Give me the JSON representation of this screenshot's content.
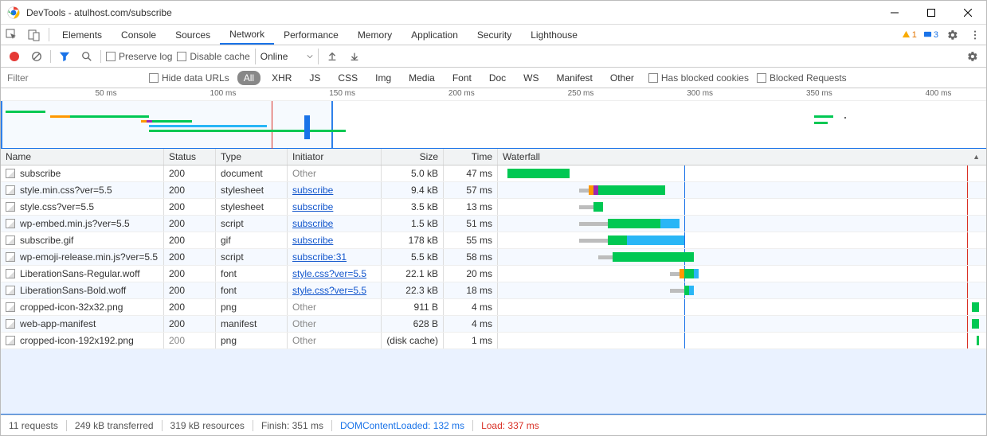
{
  "title": "DevTools - atulhost.com/subscribe",
  "tabs": [
    "Elements",
    "Console",
    "Sources",
    "Network",
    "Performance",
    "Memory",
    "Application",
    "Security",
    "Lighthouse"
  ],
  "active_tab": "Network",
  "badges": {
    "warnings": "1",
    "messages": "3"
  },
  "toolbar": {
    "preserve_log": "Preserve log",
    "disable_cache": "Disable cache",
    "online": "Online"
  },
  "filters": {
    "placeholder": "Filter",
    "hide_data_urls": "Hide data URLs",
    "types": [
      "All",
      "XHR",
      "JS",
      "CSS",
      "Img",
      "Media",
      "Font",
      "Doc",
      "WS",
      "Manifest",
      "Other"
    ],
    "has_blocked_cookies": "Has blocked cookies",
    "blocked_requests": "Blocked Requests"
  },
  "overview": {
    "ticks": [
      "50 ms",
      "100 ms",
      "150 ms",
      "200 ms",
      "250 ms",
      "300 ms",
      "350 ms",
      "400 ms"
    ]
  },
  "columns": [
    "Name",
    "Status",
    "Type",
    "Initiator",
    "Size",
    "Time",
    "Waterfall"
  ],
  "requests": [
    {
      "name": "subscribe",
      "status": "200",
      "type": "document",
      "initiator": "Other",
      "initiator_link": false,
      "size": "5.0 kB",
      "time": "47 ms"
    },
    {
      "name": "style.min.css?ver=5.5",
      "status": "200",
      "type": "stylesheet",
      "initiator": "subscribe",
      "initiator_link": true,
      "size": "9.4 kB",
      "time": "57 ms"
    },
    {
      "name": "style.css?ver=5.5",
      "status": "200",
      "type": "stylesheet",
      "initiator": "subscribe",
      "initiator_link": true,
      "size": "3.5 kB",
      "time": "13 ms"
    },
    {
      "name": "wp-embed.min.js?ver=5.5",
      "status": "200",
      "type": "script",
      "initiator": "subscribe",
      "initiator_link": true,
      "size": "1.5 kB",
      "time": "51 ms"
    },
    {
      "name": "subscribe.gif",
      "status": "200",
      "type": "gif",
      "initiator": "subscribe",
      "initiator_link": true,
      "size": "178 kB",
      "time": "55 ms"
    },
    {
      "name": "wp-emoji-release.min.js?ver=5.5",
      "status": "200",
      "type": "script",
      "initiator": "subscribe:31",
      "initiator_link": true,
      "size": "5.5 kB",
      "time": "58 ms"
    },
    {
      "name": "LiberationSans-Regular.woff",
      "status": "200",
      "type": "font",
      "initiator": "style.css?ver=5.5",
      "initiator_link": true,
      "size": "22.1 kB",
      "time": "20 ms"
    },
    {
      "name": "LiberationSans-Bold.woff",
      "status": "200",
      "type": "font",
      "initiator": "style.css?ver=5.5",
      "initiator_link": true,
      "size": "22.3 kB",
      "time": "18 ms"
    },
    {
      "name": "cropped-icon-32x32.png",
      "status": "200",
      "type": "png",
      "initiator": "Other",
      "initiator_link": false,
      "size": "911 B",
      "time": "4 ms"
    },
    {
      "name": "web-app-manifest",
      "status": "200",
      "type": "manifest",
      "initiator": "Other",
      "initiator_link": false,
      "size": "628 B",
      "time": "4 ms"
    },
    {
      "name": "cropped-icon-192x192.png",
      "status": "200",
      "status_dim": true,
      "type": "png",
      "initiator": "Other",
      "initiator_link": false,
      "size": "(disk cache)",
      "time": "1 ms"
    }
  ],
  "waterfall": {
    "blue_line_pct": 38,
    "red_line_pct": 97,
    "rows": [
      {
        "segs": [
          {
            "cls": "wf-green",
            "l": 1,
            "w": 13
          }
        ]
      },
      {
        "segs": [
          {
            "cls": "wf-gray",
            "l": 16,
            "w": 2
          },
          {
            "cls": "wf-orange",
            "l": 18,
            "w": 1
          },
          {
            "cls": "wf-purple",
            "l": 19,
            "w": 1
          },
          {
            "cls": "wf-green",
            "l": 20,
            "w": 14
          }
        ]
      },
      {
        "segs": [
          {
            "cls": "wf-gray",
            "l": 16,
            "w": 3
          },
          {
            "cls": "wf-green",
            "l": 19,
            "w": 2
          }
        ]
      },
      {
        "segs": [
          {
            "cls": "wf-gray",
            "l": 16,
            "w": 6
          },
          {
            "cls": "wf-green",
            "l": 22,
            "w": 11
          },
          {
            "cls": "wf-blue",
            "l": 33,
            "w": 4
          }
        ]
      },
      {
        "segs": [
          {
            "cls": "wf-gray",
            "l": 16,
            "w": 6
          },
          {
            "cls": "wf-green",
            "l": 22,
            "w": 4
          },
          {
            "cls": "wf-blue",
            "l": 26,
            "w": 12
          }
        ]
      },
      {
        "segs": [
          {
            "cls": "wf-gray",
            "l": 20,
            "w": 3
          },
          {
            "cls": "wf-green",
            "l": 23,
            "w": 17
          }
        ]
      },
      {
        "segs": [
          {
            "cls": "wf-gray",
            "l": 35,
            "w": 2
          },
          {
            "cls": "wf-orange",
            "l": 37,
            "w": 1
          },
          {
            "cls": "wf-green",
            "l": 38,
            "w": 2
          },
          {
            "cls": "wf-blue",
            "l": 40,
            "w": 1
          }
        ]
      },
      {
        "segs": [
          {
            "cls": "wf-gray",
            "l": 35,
            "w": 3
          },
          {
            "cls": "wf-green",
            "l": 38,
            "w": 1
          },
          {
            "cls": "wf-blue",
            "l": 39,
            "w": 1
          }
        ]
      },
      {
        "segs": [
          {
            "cls": "wf-green",
            "l": 98,
            "w": 1.5
          }
        ]
      },
      {
        "segs": [
          {
            "cls": "wf-green",
            "l": 98,
            "w": 1.5
          }
        ]
      },
      {
        "segs": [
          {
            "cls": "wf-green",
            "l": 99,
            "w": 0.5
          }
        ]
      }
    ]
  },
  "status": {
    "requests": "11 requests",
    "transferred": "249 kB transferred",
    "resources": "319 kB resources",
    "finish": "Finish: 351 ms",
    "dcl": "DOMContentLoaded: 132 ms",
    "load": "Load: 337 ms"
  }
}
